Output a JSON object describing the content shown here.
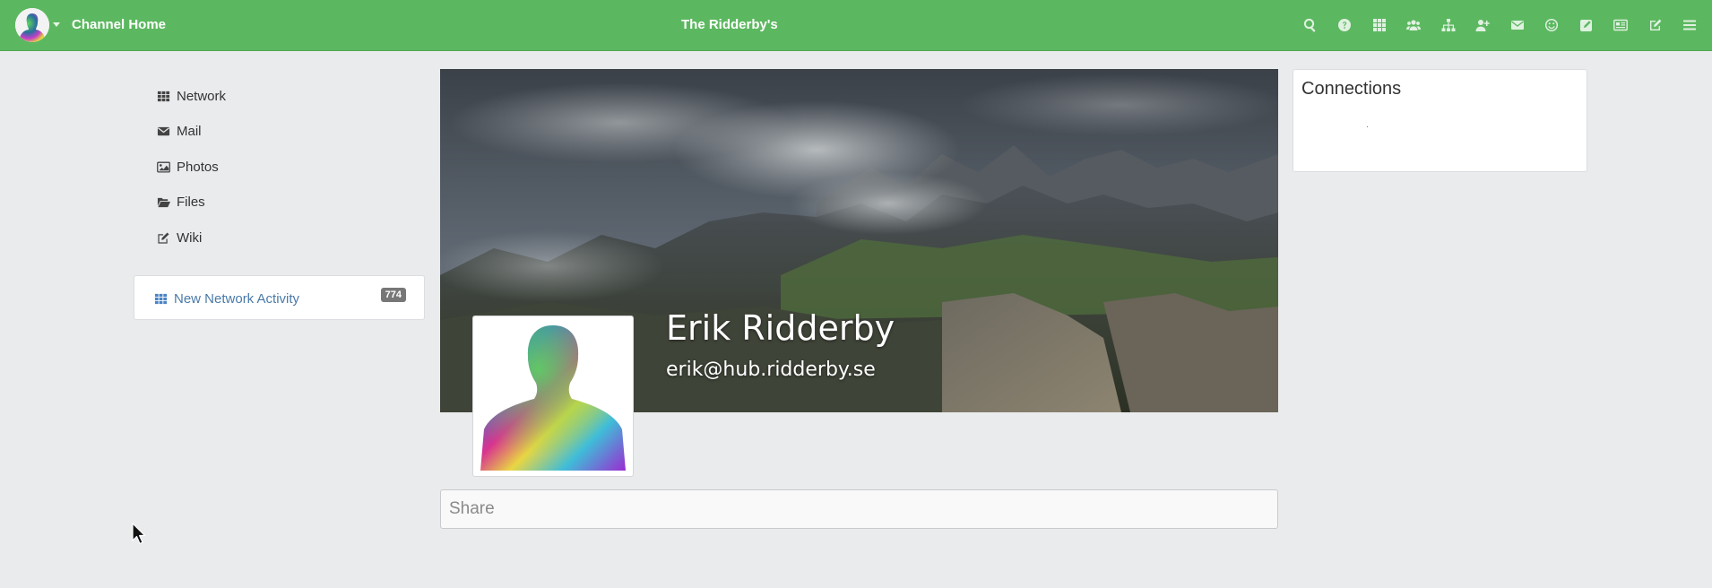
{
  "navbar": {
    "home_label": "Channel Home",
    "channel_title": "The Ridderby's",
    "icons": [
      "search-icon",
      "help-icon",
      "apps-grid-icon",
      "people-icon",
      "sitemap-icon",
      "add-user-icon",
      "envelope-icon",
      "smile-icon",
      "edit-square-icon",
      "newspaper-icon",
      "pencil-square-icon",
      "hamburger-menu-icon"
    ],
    "background_color": "#5cb860"
  },
  "sidebar": {
    "items": [
      {
        "label": "Network",
        "icon": "grid-icon"
      },
      {
        "label": "Mail",
        "icon": "envelope-icon"
      },
      {
        "label": "Photos",
        "icon": "image-icon"
      },
      {
        "label": "Files",
        "icon": "folder-open-icon"
      },
      {
        "label": "Wiki",
        "icon": "edit-icon"
      }
    ],
    "activity": {
      "label": "New Network Activity",
      "count": "774",
      "icon": "grid-icon"
    }
  },
  "profile": {
    "name": "Erik Ridderby",
    "address": "erik@hub.ridderby.se"
  },
  "share": {
    "placeholder": "Share"
  },
  "connections": {
    "title": "Connections"
  }
}
